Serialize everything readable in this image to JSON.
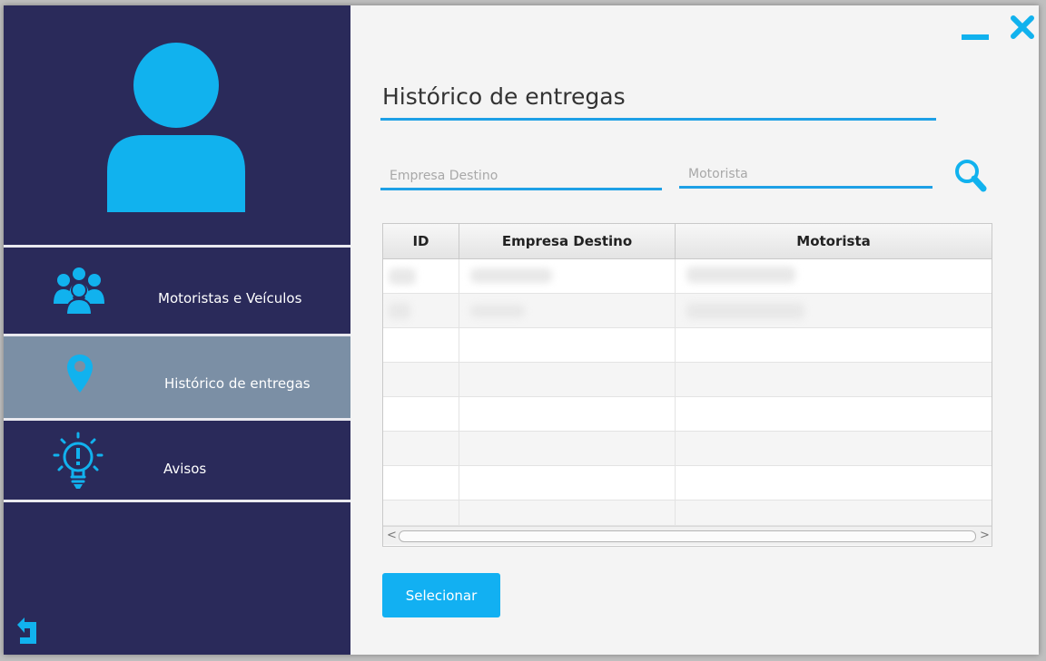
{
  "sidebar": {
    "items": [
      {
        "label": "Motoristas e Veículos",
        "icon": "users-group-icon",
        "active": false
      },
      {
        "label": "Histórico de entregas",
        "icon": "map-pin-icon",
        "active": true
      },
      {
        "label": "Avisos",
        "icon": "lightbulb-icon",
        "active": false
      }
    ],
    "back_icon": "back-arrow-icon",
    "avatar_icon": "user-avatar-icon"
  },
  "window": {
    "minimize_icon": "minimize-icon",
    "close_icon": "close-icon"
  },
  "page": {
    "title": "Histórico de entregas"
  },
  "filters": {
    "empresa_placeholder": "Empresa Destino",
    "motorista_placeholder": "Motorista",
    "search_icon": "search-icon"
  },
  "table": {
    "columns": [
      "ID",
      "Empresa Destino",
      "Motorista"
    ],
    "rows": []
  },
  "actions": {
    "select_label": "Selecionar"
  },
  "colors": {
    "sidebar_bg": "#2a2a5a",
    "active_item_bg": "#7b8fa5",
    "accent": "#1ea0e6",
    "icon_cyan": "#11b2ee",
    "button_bg": "#12b0f2",
    "content_bg": "#f4f4f4"
  }
}
